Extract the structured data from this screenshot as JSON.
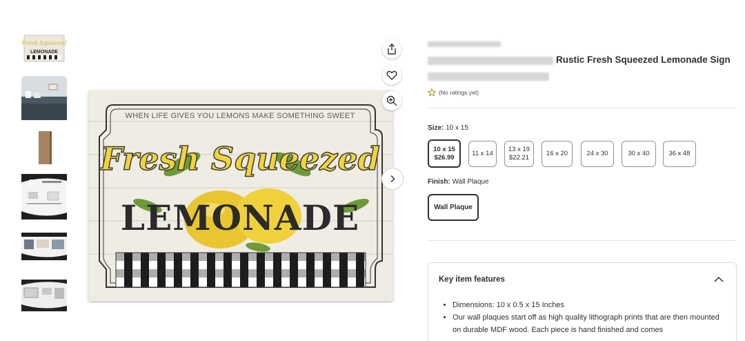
{
  "product": {
    "title": "Rustic Fresh Squeezed Lemonade Sign",
    "rating_text": "(No ratings yet)"
  },
  "image": {
    "top_text": "WHEN LIFE GIVES YOU LEMONS MAKE SOMETHING SWEET",
    "script_text": "Fresh Squeezed",
    "block_text": "LEMONADE"
  },
  "thumbnail_1": {
    "script_text": "Fresh Squeezed",
    "block_text": "LEMONADE"
  },
  "size": {
    "label": "Size:",
    "selected": "10 x 15",
    "options": [
      {
        "size": "10 x 15",
        "price": "$26.99"
      },
      {
        "size": "11 x 14",
        "price": ""
      },
      {
        "size": "13 x 19",
        "price": "$22.21"
      },
      {
        "size": "16 x 20",
        "price": ""
      },
      {
        "size": "24 x 30",
        "price": ""
      },
      {
        "size": "30 x 40",
        "price": ""
      },
      {
        "size": "36 x 48",
        "price": ""
      }
    ]
  },
  "finish": {
    "label": "Finish:",
    "selected": "Wall Plaque",
    "option": "Wall Plaque"
  },
  "features": {
    "title": "Key item features",
    "items": [
      "Dimensions: 10 x 0.5 x 15 Inches",
      "Our wall plaques start off as high quality lithograph prints that are then mounted on durable MDF wood. Each piece is hand finished and comes"
    ]
  },
  "colors": {
    "text": "#2e2f32",
    "lemon": "#f2d43a",
    "border": "#dcdcdc"
  },
  "icons": [
    "share-icon",
    "heart-icon",
    "zoom-icon",
    "chevron-right-icon",
    "star-outline-icon",
    "chevron-up-icon"
  ]
}
